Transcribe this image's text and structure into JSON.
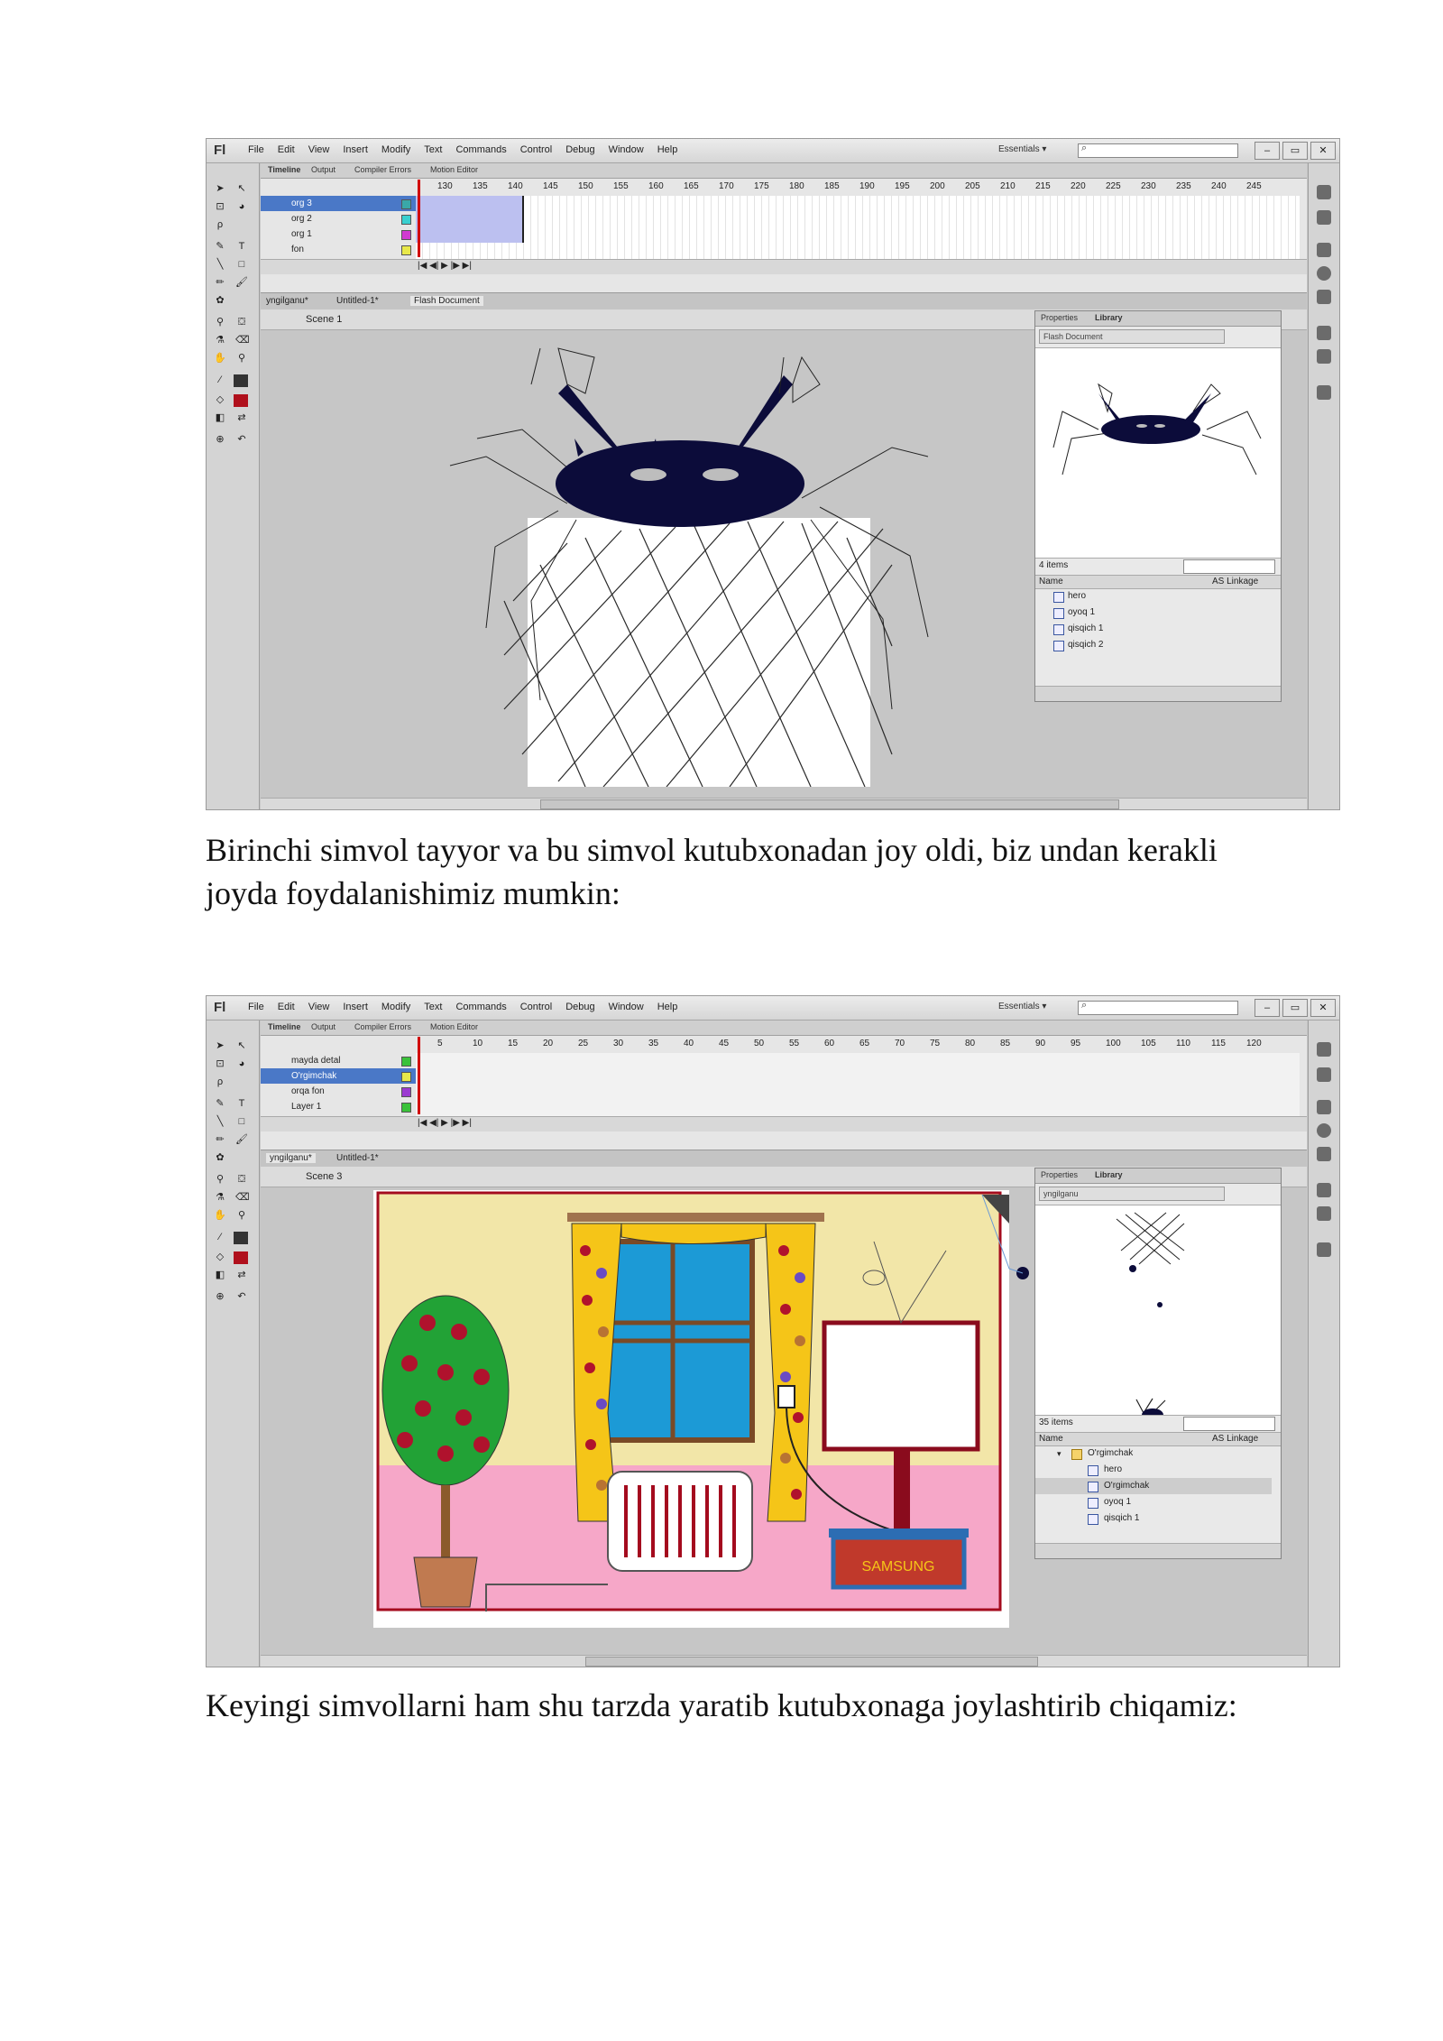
{
  "menu": [
    "File",
    "Edit",
    "View",
    "Insert",
    "Modify",
    "Text",
    "Commands",
    "Control",
    "Debug",
    "Window",
    "Help"
  ],
  "app": {
    "logo": "Fl",
    "workspace": "Essentials"
  },
  "timeline_tabs": [
    "Timeline",
    "Output",
    "Compiler Errors",
    "Motion Editor"
  ],
  "library_tabs": [
    "Properties",
    "Library"
  ],
  "library_columns": {
    "name": "Name",
    "linkage": "AS Linkage"
  },
  "shot1": {
    "ruler": [
      "130",
      "135",
      "140",
      "145",
      "150",
      "155",
      "160",
      "165",
      "170",
      "175",
      "180",
      "185",
      "190",
      "195",
      "200",
      "205",
      "210",
      "215",
      "220",
      "225",
      "230",
      "235",
      "240",
      "245"
    ],
    "layers": [
      "org 3",
      "org 2",
      "org 1",
      "fon"
    ],
    "doc_tabs": [
      "yngilganu*",
      "Untitled-1*",
      "Flash Document"
    ],
    "scene": "Scene 1",
    "doc_select": "Flash Document",
    "item_count": "4 items",
    "items": [
      "hero",
      "oyoq 1",
      "qisqich 1",
      "qisqich 2"
    ]
  },
  "paragraph1": "Birinchi simvol tayyor va bu simvol kutubxonadan joy oldi, biz undan kerakli joyda foydalanishimiz mumkin:",
  "shot2": {
    "ruler": [
      "5",
      "10",
      "15",
      "20",
      "25",
      "30",
      "35",
      "40",
      "45",
      "50",
      "55",
      "60",
      "65",
      "70",
      "75",
      "80",
      "85",
      "90",
      "95",
      "100",
      "105",
      "110",
      "115",
      "120"
    ],
    "layers": [
      "mayda detal",
      "O'rgimchak",
      "orqa fon",
      "Layer 1"
    ],
    "doc_tabs": [
      "yngilganu*",
      "Untitled-1*"
    ],
    "scene": "Scene 3",
    "doc_select": "yngilganu",
    "item_count": "35 items",
    "folder": "O'rgimchak",
    "items": [
      "hero",
      "O'rgimchak",
      "oyoq 1",
      "qisqich 1"
    ],
    "tv_brand": "SAMSUNG"
  },
  "paragraph2": "Keyingi simvollarni ham shu tarzda yaratib kutubxonaga joylashtirib chiqamiz:",
  "colors": {
    "spider": "#0c0c3a",
    "curtain": "#f5c518",
    "window_glass": "#1c9ad6",
    "wall": "#f2e6a8",
    "floor": "#f6a7c8",
    "tree": "#22a236",
    "berries": "#b0122d",
    "tv_stand": "#8a0b1d",
    "cabinet": "#2c6db3",
    "cabinet_top": "#c0392b"
  }
}
